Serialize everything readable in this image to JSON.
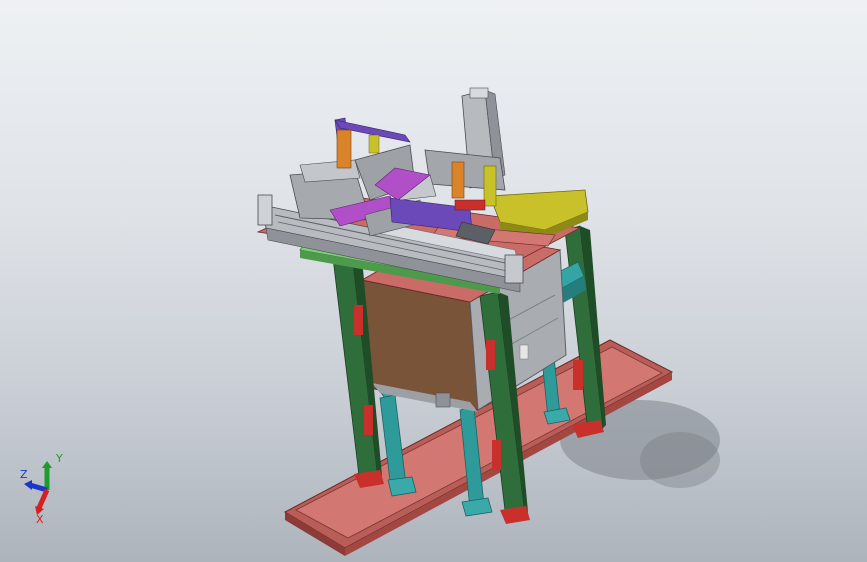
{
  "viewport": {
    "background_top": "#eef1f4",
    "background_bottom": "#aeb4bc"
  },
  "colors": {
    "base_tray": "#c96b66",
    "frame_green": "#2f6e3b",
    "frame_teal": "#2f9a9a",
    "box_brown": "#7a5439",
    "panel_gray": "#a9adb2",
    "plate_yellow": "#c9c12a",
    "rail_green": "#7ccf7a",
    "accent_purple": "#6b49b8",
    "accent_magenta": "#b04fc8",
    "accent_orange": "#d9832a",
    "accent_red": "#c9302c"
  },
  "triad": {
    "x_label": "X",
    "y_label": "Y",
    "z_label": "Z",
    "x_color": "#d42020",
    "y_color": "#1d9b2c",
    "z_color": "#1c36c8"
  }
}
